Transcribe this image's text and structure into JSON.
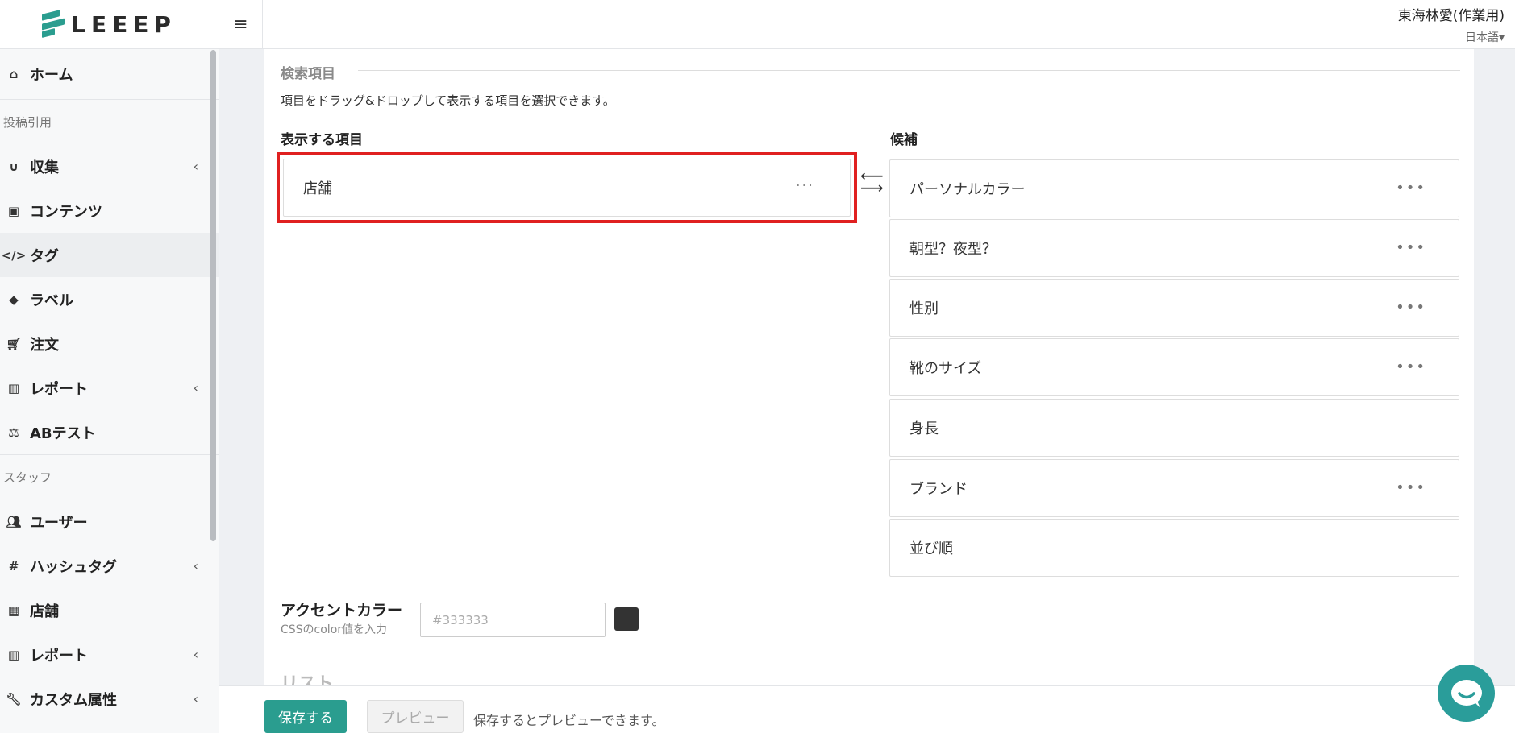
{
  "logo": {
    "text": "LEEEP"
  },
  "header": {
    "user": "東海林愛(作業用)",
    "language": "日本語▾",
    "menu_icon": "hamburger-icon"
  },
  "sidebar": {
    "home": "ホーム",
    "section1": "投稿引用",
    "collect": "収集",
    "contents": "コンテンツ",
    "tags": "タグ",
    "labels": "ラベル",
    "orders": "注文",
    "report1": "レポート",
    "ab_test": "ABテスト",
    "section2": "スタッフ",
    "users": "ユーザー",
    "hashtag": "ハッシュタグ",
    "stores": "店舗",
    "report2": "レポート",
    "custom_attr": "カスタム属性"
  },
  "search_section": {
    "title": "検索項目",
    "description": "項目をドラッグ&ドロップして表示する項目を選択できます。",
    "shown_label": "表示する項目",
    "candidates_label": "候補",
    "shown_items": [
      {
        "label": "店舗",
        "dots": "···"
      }
    ],
    "candidates": [
      {
        "label": "パーソナルカラー",
        "dots": "•••"
      },
      {
        "label": "朝型？夜型？",
        "dots": "•••"
      },
      {
        "label": "性別",
        "dots": "•••"
      },
      {
        "label": "靴のサイズ",
        "dots": "•••"
      },
      {
        "label": "身長",
        "dots": ""
      },
      {
        "label": "ブランド",
        "dots": "•••"
      },
      {
        "label": "並び順",
        "dots": ""
      }
    ]
  },
  "accent": {
    "label": "アクセントカラー",
    "sub": "CSSのcolor値を入力",
    "placeholder": "#333333",
    "swatch_color": "#333333"
  },
  "list_section": {
    "title": "リスト"
  },
  "footer": {
    "save": "保存する",
    "preview": "プレビュー",
    "note": "保存するとプレビューできます。"
  },
  "colors": {
    "accent": "#2a9d8f",
    "highlight": "#e02020"
  }
}
